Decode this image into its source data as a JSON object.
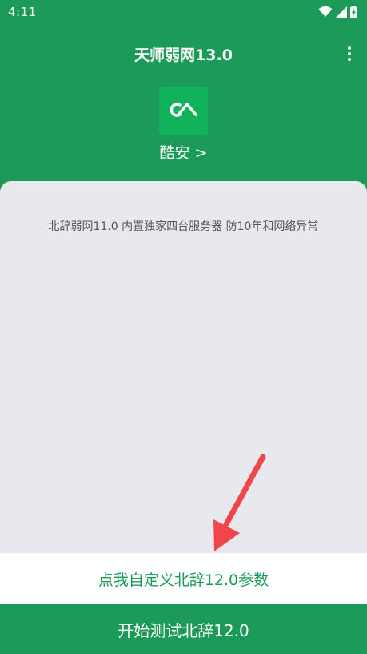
{
  "status_bar": {
    "time": "4:11",
    "icons": [
      "wifi-icon",
      "signal-icon",
      "battery-charging-icon"
    ]
  },
  "app_bar": {
    "title": "天师弱网13.0",
    "menu_icon": "more-vert-icon"
  },
  "brand": {
    "logo_icon": "coolapk-logo-icon",
    "link_label": "酷安 >"
  },
  "content": {
    "description": "北辞弱网11.0 内置独家四台服务器 防10年和网络异常"
  },
  "buttons": {
    "custom_params_label": "点我自定义北辞12.0参数",
    "start_test_label": "开始测试北辞12.0"
  },
  "colors": {
    "primary_green": "#1b9a58",
    "logo_green": "#12b15c",
    "card_background": "#e8e9ee",
    "annotation_arrow": "#f0464a"
  }
}
